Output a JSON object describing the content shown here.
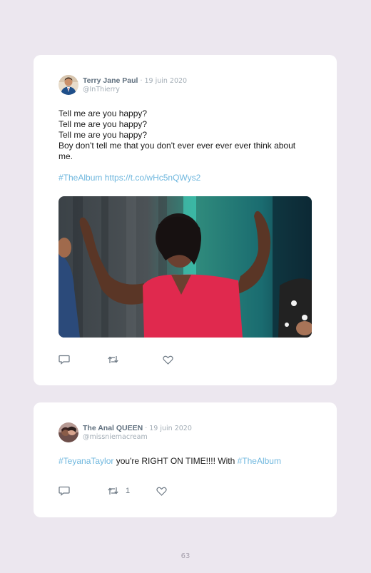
{
  "tweets": [
    {
      "author_name": "Terry Jane Paul",
      "date": "· 19 juin 2020",
      "handle": "@InThierry",
      "lines": [
        "Tell me are you happy?",
        "Tell me are you happy?",
        "Tell me are you happy?",
        "Boy don't tell me that you don't ever ever ever ever think about me."
      ],
      "hashtag": "#TheAlbum",
      "url": "https://t.co/wHc5nQWys2",
      "retweet_count": ""
    },
    {
      "author_name": "The Anal QUEEN",
      "date": "· 19 juin 2020",
      "handle": "@missniemacream",
      "hashtag_1": "#TeyanaTaylor",
      "text": " you're RIGHT ON TIME!!!! With ",
      "hashtag_2": "#TheAlbum",
      "retweet_count": "1"
    }
  ],
  "icons": {
    "reply": "comment-icon",
    "retweet": "retweet-icon",
    "like": "heart-icon"
  },
  "colors": {
    "background": "#ece7ef",
    "card": "#ffffff",
    "link": "#6fb7de",
    "name": "#5f6f7e",
    "meta": "#a3adb6"
  },
  "page_number": "63"
}
